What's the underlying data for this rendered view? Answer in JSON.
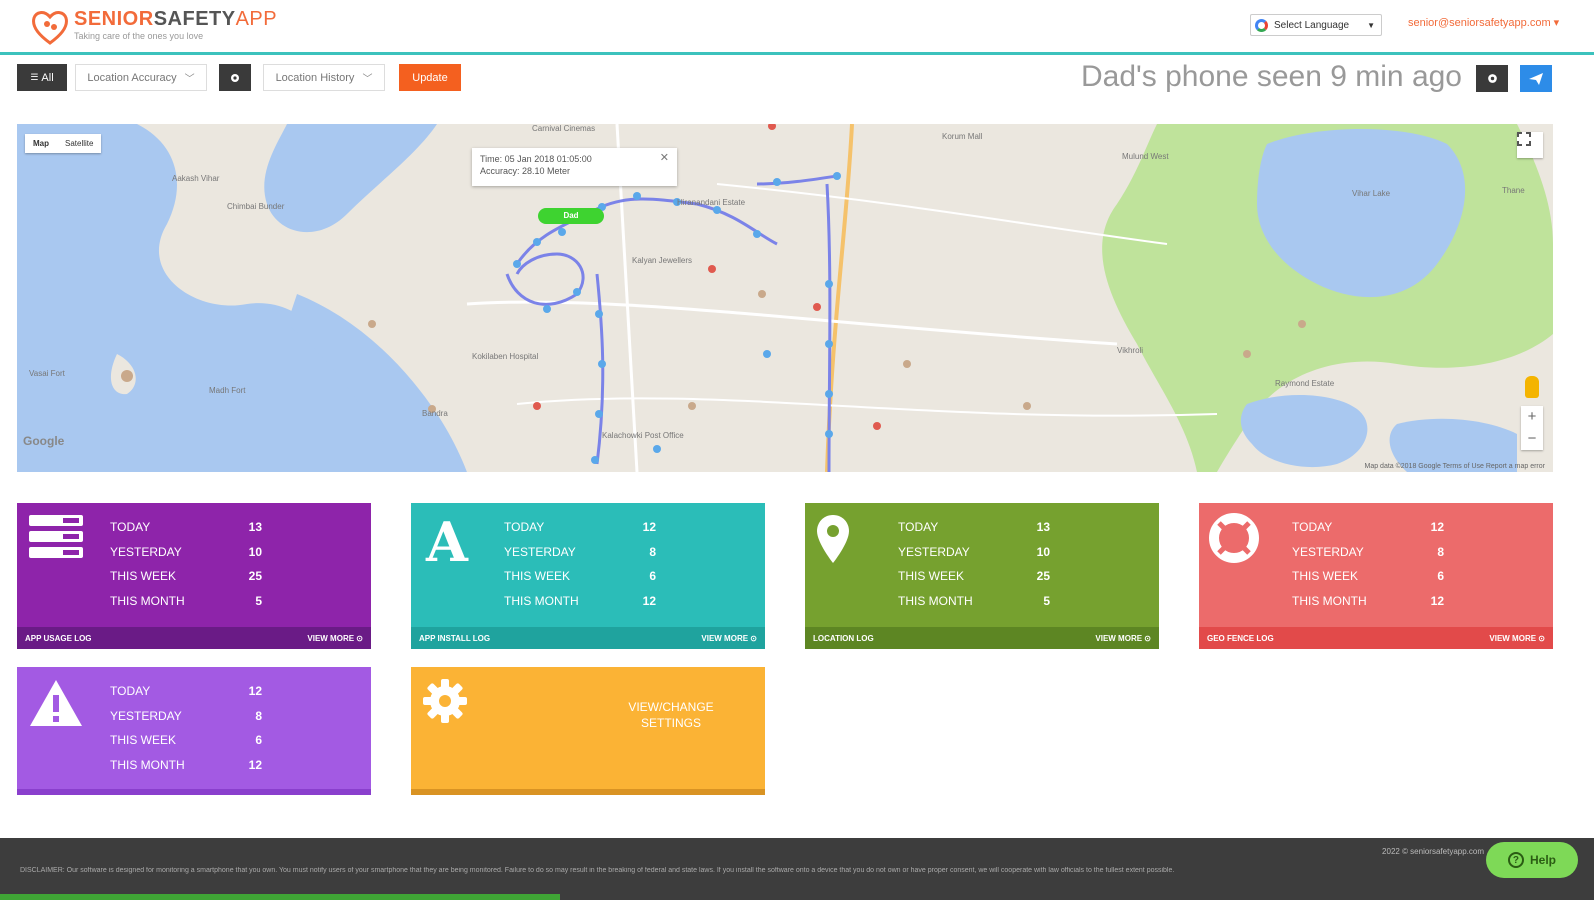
{
  "header": {
    "brand_senior": "SENIOR",
    "brand_safety": "SAFETY",
    "brand_app": "APP",
    "tagline": "Taking care of the ones you love",
    "language_label": "Select Language",
    "user_email": "senior@seniorsafetyapp.com"
  },
  "toolbar": {
    "all_label": "All",
    "location_accuracy": "Location Accuracy",
    "location_history": "Location History",
    "update_label": "Update"
  },
  "status": {
    "seen_text": "Dad's phone seen 9 min ago"
  },
  "map": {
    "toggle_map": "Map",
    "toggle_satellite": "Satellite",
    "info_time": "Time: 05 Jan 2018 01:05:00",
    "info_accuracy": "Accuracy: 28.10 Meter",
    "marker_label": "Dad",
    "google_mark": "Google",
    "footer": "Map data ©2018 Google   Terms of Use   Report a map error",
    "labels": [
      "Carnival Cinemas",
      "Korum Mall",
      "Aakash Vihar",
      "Chimbai Bunder",
      "Hiranandani Estate",
      "Mulund West",
      "Kalyan Jewellers",
      "Kokilaben Hospital",
      "Vasai Fort",
      "Madh Fort",
      "Bandra",
      "Vihar Lake",
      "Vikhroli",
      "Raymond Estate",
      "Thane",
      "Kalachowki Post Office"
    ]
  },
  "stat_labels": {
    "today": "TODAY",
    "yesterday": "YESTERDAY",
    "this_week": "THIS WEEK",
    "this_month": "THIS MONTH"
  },
  "cards": {
    "app_usage": {
      "today": "13",
      "yesterday": "10",
      "week": "25",
      "month": "5",
      "title": "APP USAGE LOG",
      "more": "VIEW MORE"
    },
    "app_install": {
      "today": "12",
      "yesterday": "8",
      "week": "6",
      "month": "12",
      "title": "APP INSTALL LOG",
      "more": "VIEW MORE"
    },
    "location": {
      "today": "13",
      "yesterday": "10",
      "week": "25",
      "month": "5",
      "title": "LOCATION LOG",
      "more": "VIEW MORE"
    },
    "geo_fence": {
      "today": "12",
      "yesterday": "8",
      "week": "6",
      "month": "12",
      "title": "GEO FENCE LOG",
      "more": "VIEW MORE"
    },
    "alerts": {
      "today": "12",
      "yesterday": "8",
      "week": "6",
      "month": "12"
    },
    "settings": {
      "label_line1": "VIEW/CHANGE",
      "label_line2": "SETTINGS"
    }
  },
  "footer": {
    "copyright": "2022 © seniorsafetyapp.com",
    "disclaimer": "DISCLAIMER: Our software is designed for monitoring a smartphone that you own. You must notify users of your smartphone that they are being monitored. Failure to do so may result in the breaking of federal and state laws. If you install the software onto a device that you do not own or have proper consent, we will cooperate with law officials to the fullest extent possible.",
    "help_label": "Help"
  },
  "colors": {
    "accent_teal": "#3cc2bd",
    "brand_orange": "#f26b3a",
    "update_orange": "#f4601f",
    "card_purple": "#8e24aa",
    "card_teal": "#2bbdb8",
    "card_green": "#76a12f",
    "card_red": "#ec6b6b",
    "card_violet": "#a35ae3",
    "card_orange": "#fbb335"
  },
  "icons": [
    "heart-logo-icon",
    "google-icon",
    "chevron-down-icon",
    "gear-icon",
    "send-icon",
    "fullscreen-icon",
    "list-icon",
    "font-a-icon",
    "map-pin-icon",
    "lifebuoy-icon",
    "warning-icon",
    "settings-gear-icon",
    "help-icon"
  ]
}
